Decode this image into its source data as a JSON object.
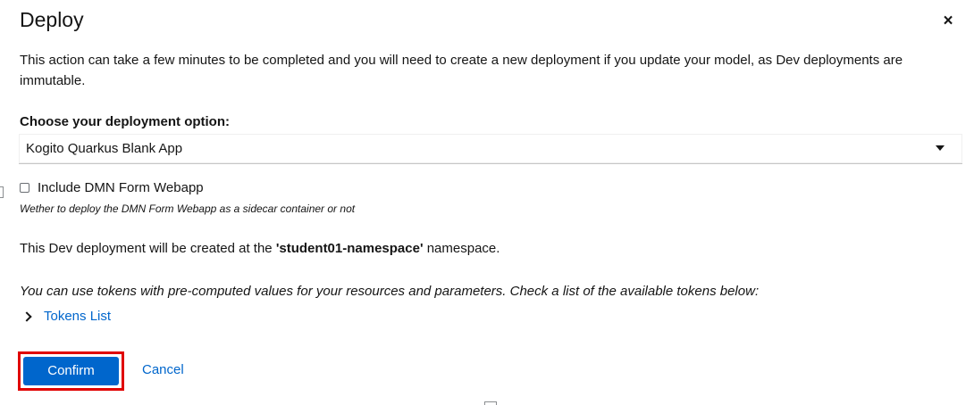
{
  "dialog": {
    "title": "Deploy",
    "close_icon_glyph": "×",
    "description": "This action can take a few minutes to be completed and you will need to create a new deployment if you update your model, as Dev deployments are immutable."
  },
  "deployment_option": {
    "label": "Choose your deployment option:",
    "selected": "Kogito Quarkus Blank App",
    "caret_icon": "caret-down-icon"
  },
  "dmn_form": {
    "checkbox_label": "Include DMN Form Webapp",
    "checked": false,
    "helper_text": "Wether to deploy the DMN Form Webapp as a sidecar container or not"
  },
  "namespace": {
    "prefix": "This Dev deployment will be created at the",
    "name": "'student01-namespace'",
    "suffix": "namespace."
  },
  "tokens": {
    "description": "You can use tokens with pre-computed values for your resources and parameters. Check a list of the available tokens below:",
    "toggle_label": "Tokens List",
    "expand_icon": "chevron-right-icon"
  },
  "actions": {
    "confirm_label": "Confirm",
    "cancel_label": "Cancel",
    "highlight_color": "#e00000",
    "primary_color": "#0066cc",
    "link_color": "#0066cc"
  }
}
